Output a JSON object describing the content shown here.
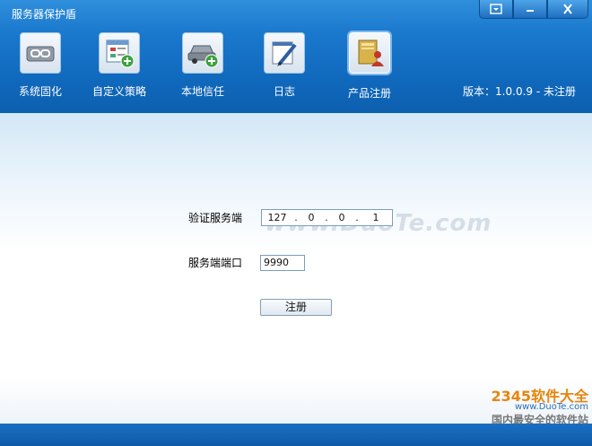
{
  "app": {
    "title": "服务器保护盾",
    "version": "版本：1.0.0.9 - 未注册"
  },
  "window_controls": {
    "menu_icon": "menu-icon",
    "minimize_icon": "minimize-icon",
    "close_icon": "close-icon"
  },
  "toolbar": {
    "items": [
      {
        "label": "系统固化",
        "icon": "chain-lock-icon"
      },
      {
        "label": "自定义策略",
        "icon": "policy-add-icon"
      },
      {
        "label": "本地信任",
        "icon": "car-add-icon"
      },
      {
        "label": "日志",
        "icon": "log-pen-icon"
      },
      {
        "label": "产品注册",
        "icon": "register-book-icon"
      }
    ],
    "active_index": 4
  },
  "form": {
    "server_label": "验证服务端",
    "ip": [
      "127",
      "0",
      "0",
      "1"
    ],
    "port_label": "服务端端口",
    "port_value": "9990",
    "register_button": "注册"
  },
  "watermarks": {
    "center": "www.DuoTe.com",
    "brand": "2345软件大全",
    "url": "www.DuoTe.com",
    "tagline": "国内最安全的软件站"
  },
  "colors": {
    "header": "#1a78cd",
    "footer": "#0f5aa8"
  }
}
